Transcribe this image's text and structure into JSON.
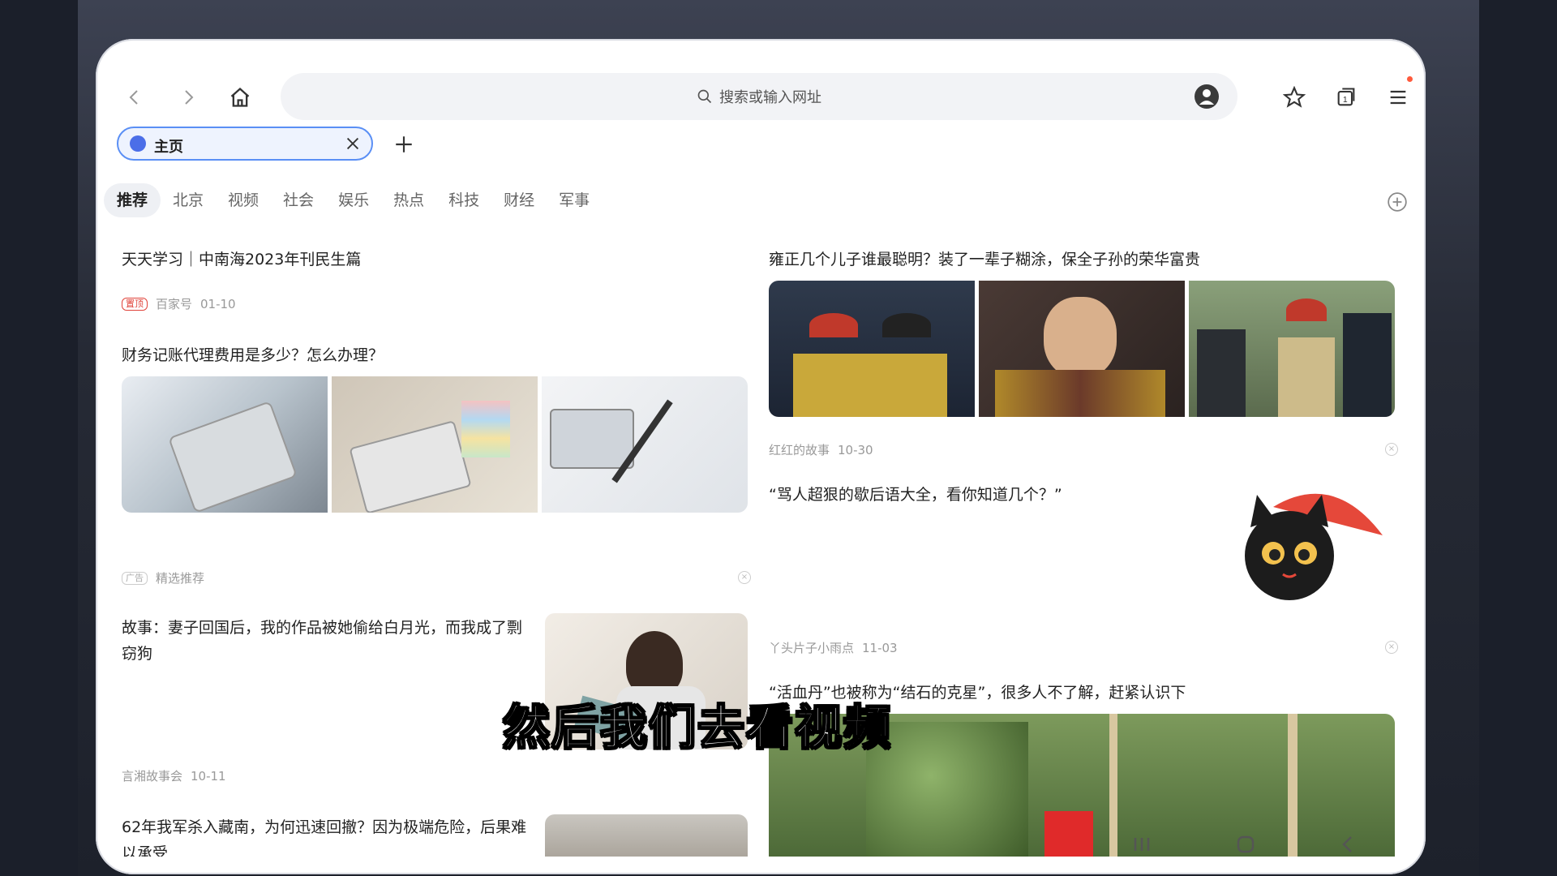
{
  "browser": {
    "address_placeholder": "搜索或输入网址",
    "tab_label": "主页",
    "tab_count": "1"
  },
  "categories": [
    "推荐",
    "北京",
    "视频",
    "社会",
    "娱乐",
    "热点",
    "科技",
    "财经",
    "军事"
  ],
  "feed_left": {
    "item1": {
      "title": "天天学习｜中南海2023年刊民生篇",
      "tag": "置顶",
      "source": "百家号",
      "date": "01-10"
    },
    "item2": {
      "title": "财务记账代理费用是多少？怎么办理？",
      "tag": "广告",
      "source": "精选推荐"
    },
    "item3": {
      "title": "故事：妻子回国后，我的作品被她偷给白月光，而我成了剽窃狗",
      "source": "言湘故事会",
      "date": "10-11"
    },
    "item4": {
      "title": "62年我军杀入藏南，为何迅速回撤？因为极端危险，后果难以承受"
    }
  },
  "feed_right": {
    "item1": {
      "title": "雍正几个儿子谁最聪明？装了一辈子糊涂，保全子孙的荣华富贵",
      "source": "红红的故事",
      "date": "10-30"
    },
    "item2": {
      "title": "“骂人超狠的歇后语大全，看你知道几个？”",
      "source": "丫头片子小雨点",
      "date": "11-03"
    },
    "item3": {
      "title": "“活血丹”也被称为“结石的克星”，很多人不了解，赶紧认识下"
    }
  },
  "subtitle": "然后我们去看视频",
  "icons": {
    "back": "chevron-left-icon",
    "forward": "chevron-right-icon",
    "home": "home-icon",
    "search": "search-icon",
    "account": "user-icon",
    "favorites": "star-icon",
    "tabs": "tabs-icon",
    "menu": "menu-icon"
  },
  "colors": {
    "accent": "#5a8ff5",
    "tag_red": "#e0433a"
  }
}
